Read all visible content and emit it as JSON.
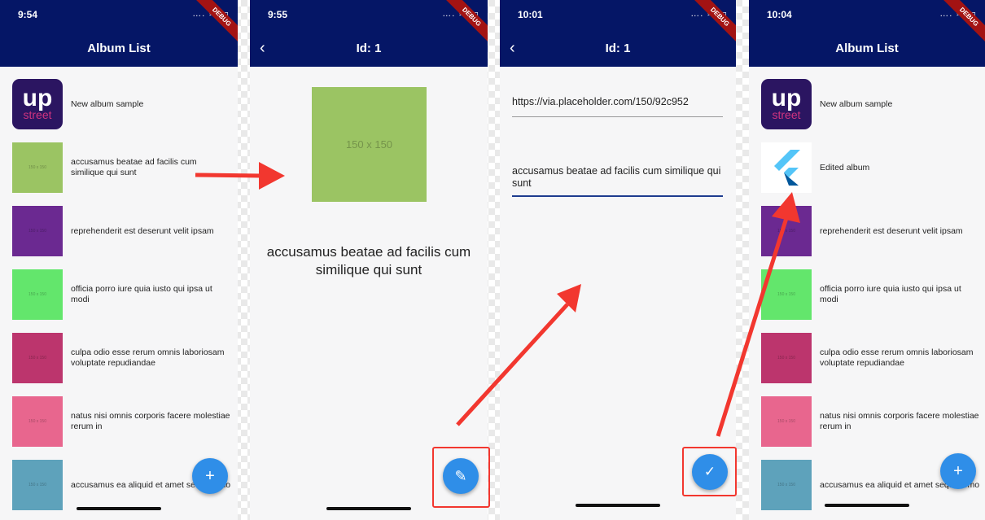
{
  "screen1": {
    "time": "9:54",
    "status_icons": "…. ≋ ▭",
    "debug": "DEBUG",
    "title": "Album List",
    "items": [
      {
        "title": "New album sample",
        "thumb_text": "",
        "color": "#2b1561",
        "logo": "upstreet"
      },
      {
        "title": "accusamus beatae ad facilis cum similique qui sunt",
        "thumb_text": "150 x 150",
        "color": "#9bc463"
      },
      {
        "title": "reprehenderit est deserunt velit ipsam",
        "thumb_text": "150 x 150",
        "color": "#6b2991"
      },
      {
        "title": "officia porro iure quia iusto qui ipsa ut modi",
        "thumb_text": "150 x 150",
        "color": "#63e66c"
      },
      {
        "title": "culpa odio esse rerum omnis laboriosam voluptate repudiandae",
        "thumb_text": "150 x 150",
        "color": "#bc356d"
      },
      {
        "title": "natus nisi omnis corporis facere molestiae rerum in",
        "thumb_text": "150 x 150",
        "color": "#e8668e"
      },
      {
        "title": "accusamus ea aliquid et amet sequi nemo",
        "thumb_text": "150 x 150",
        "color": "#5ea2bb"
      }
    ],
    "fab_icon": "+"
  },
  "screen2": {
    "time": "9:55",
    "status_icons": "…. ≋ ▭",
    "debug": "DEBUG",
    "back_icon": "‹",
    "title": "Id: 1",
    "image_text": "150 x 150",
    "album_title": "accusamus beatae ad facilis cum similique qui sunt",
    "fab_icon": "✎"
  },
  "screen3": {
    "time": "10:01",
    "status_icons": "…. ≋ ▭",
    "debug": "DEBUG",
    "back_icon": "‹",
    "title": "Id: 1",
    "url_value": "https://via.placeholder.com/150/92c952",
    "title_value": "accusamus beatae ad facilis cum similique qui sunt",
    "fab_icon": "✓"
  },
  "screen4": {
    "time": "10:04",
    "status_icons": "…. ≋ ▭",
    "debug": "DEBUG",
    "title": "Album List",
    "items": [
      {
        "title": "New album sample",
        "thumb_text": "",
        "color": "#2b1561",
        "logo": "upstreet"
      },
      {
        "title": "Edited album",
        "thumb_text": "",
        "color": "#ffffff",
        "logo": "flutter"
      },
      {
        "title": "reprehenderit est deserunt velit ipsam",
        "thumb_text": "150 x 150",
        "color": "#6b2991"
      },
      {
        "title": "officia porro iure quia iusto qui ipsa ut modi",
        "thumb_text": "150 x 150",
        "color": "#63e66c"
      },
      {
        "title": "culpa odio esse rerum omnis laboriosam voluptate repudiandae",
        "thumb_text": "150 x 150",
        "color": "#bc356d"
      },
      {
        "title": "natus nisi omnis corporis facere molestiae rerum in",
        "thumb_text": "150 x 150",
        "color": "#e8668e"
      },
      {
        "title": "accusamus ea aliquid et amet sequi nemo",
        "thumb_text": "150 x 150",
        "color": "#5ea2bb"
      }
    ],
    "fab_icon": "+"
  },
  "logos": {
    "upstreet_top": "up",
    "upstreet_bottom": "street"
  },
  "colors": {
    "appbar": "#051666",
    "fab": "#2f8ee8",
    "highlight": "#f2372f"
  }
}
